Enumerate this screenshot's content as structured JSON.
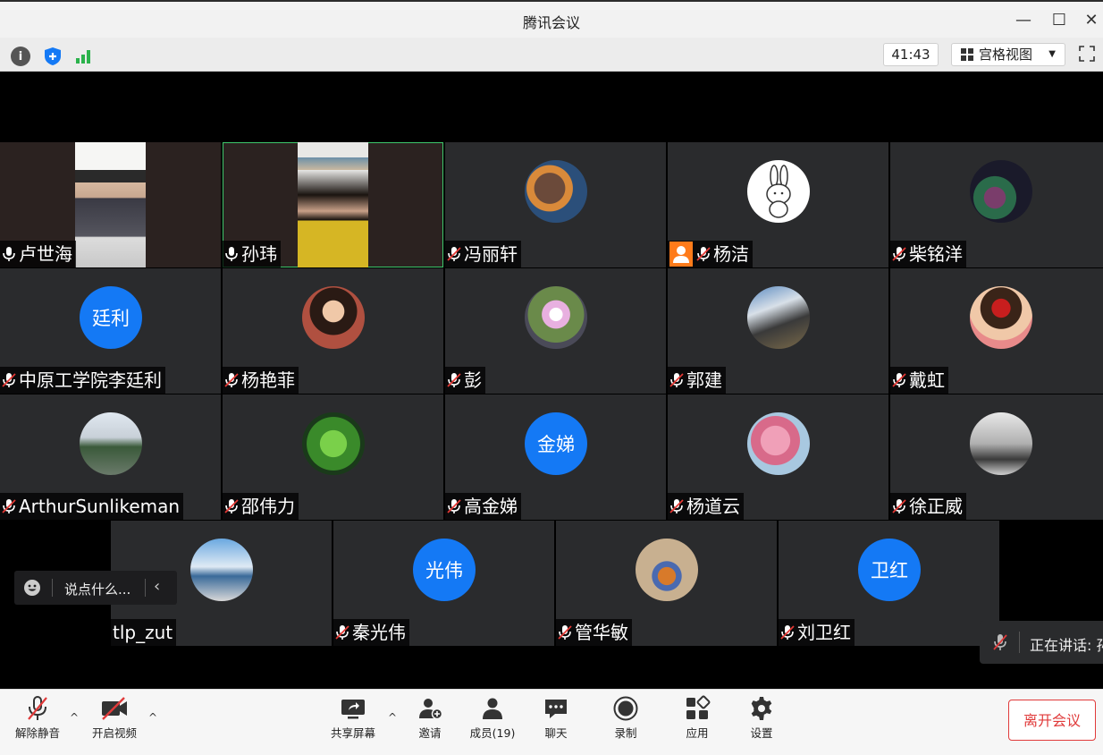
{
  "window": {
    "title": "腾讯会议",
    "minimize_label": "—",
    "maximize_label": "☐",
    "close_label": "✕"
  },
  "infobar": {
    "timer": "41:43",
    "view_label": "宫格视图"
  },
  "participants": [
    {
      "name": "卢世海",
      "avatar_text": ""
    },
    {
      "name": "孙玮",
      "avatar_text": ""
    },
    {
      "name": "冯丽轩",
      "avatar_text": ""
    },
    {
      "name": "杨洁",
      "avatar_text": ""
    },
    {
      "name": "柴铭洋",
      "avatar_text": ""
    },
    {
      "name": "中原工学院李廷利",
      "avatar_text": "廷利"
    },
    {
      "name": "杨艳菲",
      "avatar_text": ""
    },
    {
      "name": "彭",
      "avatar_text": ""
    },
    {
      "name": "郭建",
      "avatar_text": ""
    },
    {
      "name": "戴虹",
      "avatar_text": ""
    },
    {
      "name": "ArthurSunlikeman",
      "avatar_text": ""
    },
    {
      "name": "邵伟力",
      "avatar_text": ""
    },
    {
      "name": "高金娣",
      "avatar_text": "金娣"
    },
    {
      "name": "杨道云",
      "avatar_text": ""
    },
    {
      "name": "徐正威",
      "avatar_text": ""
    },
    {
      "name": "tlp_zut",
      "avatar_text": ""
    },
    {
      "name": "秦光伟",
      "avatar_text": "光伟"
    },
    {
      "name": "管华敏",
      "avatar_text": ""
    },
    {
      "name": "刘卫红",
      "avatar_text": "卫红"
    }
  ],
  "chat": {
    "placeholder": "说点什么..."
  },
  "speaking": {
    "label": "正在讲话: 孙"
  },
  "toolbar": {
    "unmute": "解除静音",
    "start_video": "开启视频",
    "share_screen": "共享屏幕",
    "invite": "邀请",
    "members": "成员(19)",
    "chat": "聊天",
    "record": "录制",
    "apps": "应用",
    "settings": "设置",
    "leave": "离开会议"
  },
  "colors": {
    "accent": "#1479f5",
    "speaking_border": "#3ec76b",
    "leave": "#e03a3a",
    "host_badge": "#ff7b1a"
  }
}
